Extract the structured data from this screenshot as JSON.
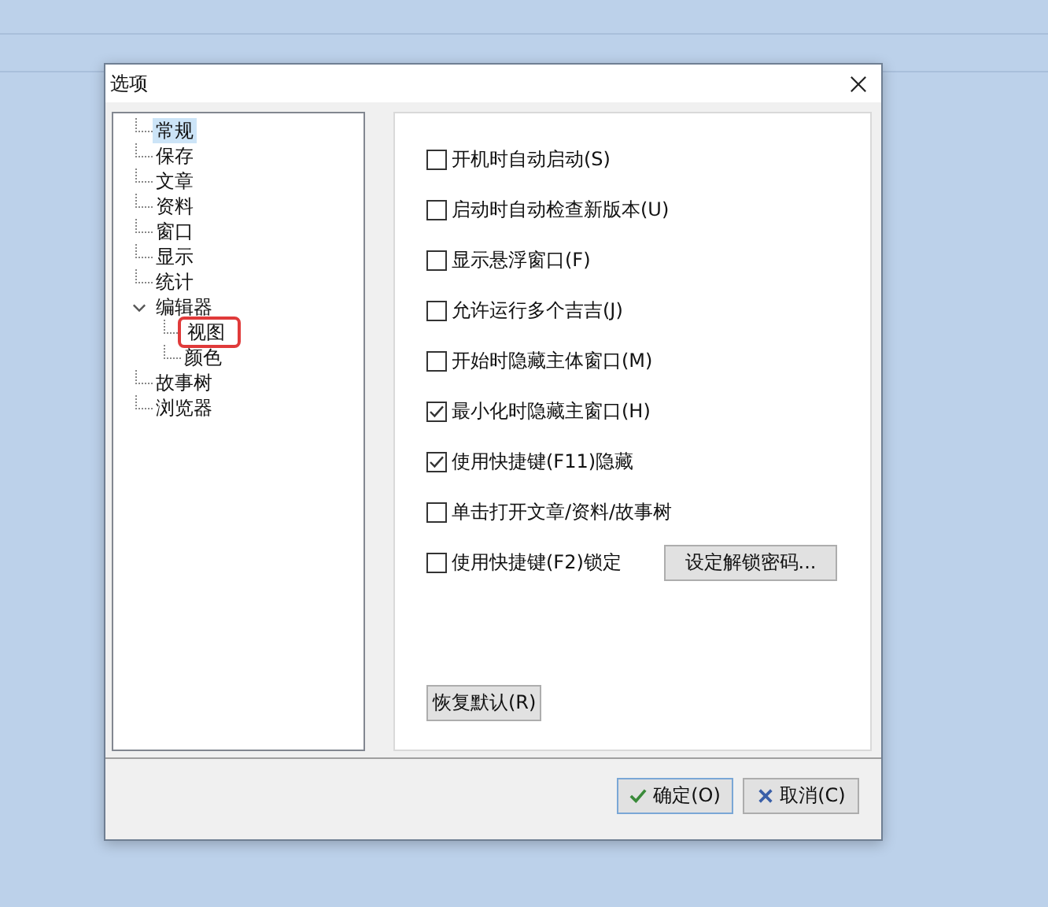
{
  "window": {
    "title": "选项"
  },
  "tree": [
    {
      "label": "常规",
      "selected": true
    },
    {
      "label": "保存",
      "selected": false
    },
    {
      "label": "文章",
      "selected": false
    },
    {
      "label": "资料",
      "selected": false
    },
    {
      "label": "窗口",
      "selected": false
    },
    {
      "label": "显示",
      "selected": false
    },
    {
      "label": "统计",
      "selected": false
    },
    {
      "label": "编辑器",
      "selected": false,
      "expanded": true,
      "children": [
        {
          "label": "视图",
          "selected": false,
          "annotated": true
        },
        {
          "label": "颜色",
          "selected": false
        }
      ]
    },
    {
      "label": "故事树",
      "selected": false
    },
    {
      "label": "浏览器",
      "selected": false
    }
  ],
  "options": [
    {
      "kind": "checkbox",
      "label": "开机时自动启动(S)",
      "checked": false
    },
    {
      "kind": "checkbox",
      "label": "启动时自动检查新版本(U)",
      "checked": false
    },
    {
      "kind": "checkbox",
      "label": "显示悬浮窗口(F)",
      "checked": false
    },
    {
      "kind": "checkbox",
      "label": "允许运行多个吉吉(J)",
      "checked": false
    },
    {
      "kind": "checkbox",
      "label": "开始时隐藏主体窗口(M)",
      "checked": false
    },
    {
      "kind": "checkbox",
      "label": "最小化时隐藏主窗口(H)",
      "checked": true
    },
    {
      "kind": "checkbox",
      "label": "使用快捷键(F11)隐藏",
      "checked": true
    },
    {
      "kind": "checkbox",
      "label": "单击打开文章/资料/故事树",
      "checked": false
    },
    {
      "kind": "checkbox",
      "label": "使用快捷键(F2)锁定",
      "checked": false,
      "button": "设定解锁密码..."
    }
  ],
  "reset_button": "恢复默认(R)",
  "buttons": [
    {
      "kind": "ok",
      "label": "确定(O)"
    },
    {
      "kind": "cancel",
      "label": "取消(C)"
    }
  ]
}
